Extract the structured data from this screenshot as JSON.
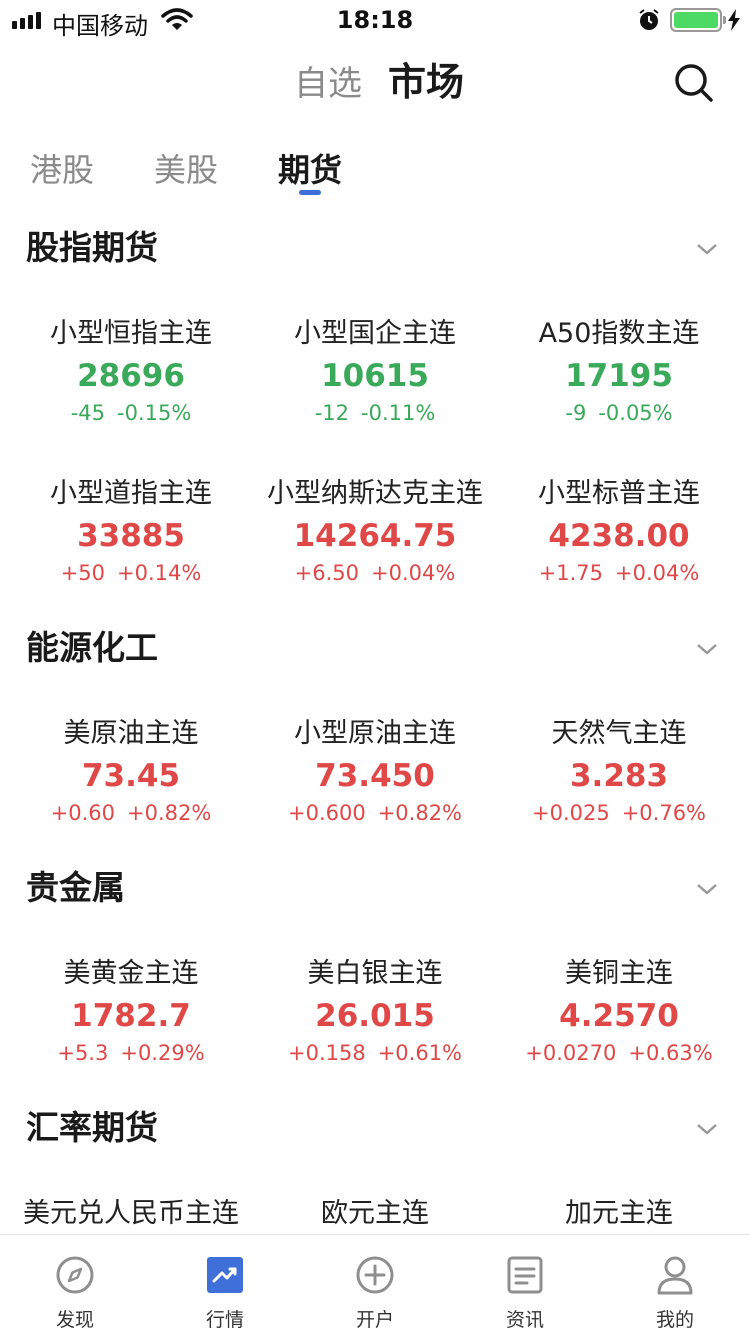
{
  "status_bar": {
    "carrier": "中国移动",
    "time": "18:18",
    "battery_color": "#4cd964"
  },
  "header": {
    "tab_watchlist": "自选",
    "tab_market": "市场"
  },
  "sub_tabs": [
    "港股",
    "美股",
    "期货"
  ],
  "colors": {
    "up": "#e04848",
    "down": "#3aaa5a",
    "accent": "#3f6fd8"
  },
  "sections": [
    {
      "title": "股指期货",
      "items": [
        {
          "name": "小型恒指主连",
          "price": "28696",
          "change": "-45",
          "pct": "-0.15%",
          "trend": "down"
        },
        {
          "name": "小型国企主连",
          "price": "10615",
          "change": "-12",
          "pct": "-0.11%",
          "trend": "down"
        },
        {
          "name": "A50指数主连",
          "price": "17195",
          "change": "-9",
          "pct": "-0.05%",
          "trend": "down"
        },
        {
          "name": "小型道指主连",
          "price": "33885",
          "change": "+50",
          "pct": "+0.14%",
          "trend": "up"
        },
        {
          "name": "小型纳斯达克主连",
          "price": "14264.75",
          "change": "+6.50",
          "pct": "+0.04%",
          "trend": "up"
        },
        {
          "name": "小型标普主连",
          "price": "4238.00",
          "change": "+1.75",
          "pct": "+0.04%",
          "trend": "up"
        }
      ]
    },
    {
      "title": "能源化工",
      "items": [
        {
          "name": "美原油主连",
          "price": "73.45",
          "change": "+0.60",
          "pct": "+0.82%",
          "trend": "up"
        },
        {
          "name": "小型原油主连",
          "price": "73.450",
          "change": "+0.600",
          "pct": "+0.82%",
          "trend": "up"
        },
        {
          "name": "天然气主连",
          "price": "3.283",
          "change": "+0.025",
          "pct": "+0.76%",
          "trend": "up"
        }
      ]
    },
    {
      "title": "贵金属",
      "items": [
        {
          "name": "美黄金主连",
          "price": "1782.7",
          "change": "+5.3",
          "pct": "+0.29%",
          "trend": "up"
        },
        {
          "name": "美白银主连",
          "price": "26.015",
          "change": "+0.158",
          "pct": "+0.61%",
          "trend": "up"
        },
        {
          "name": "美铜主连",
          "price": "4.2570",
          "change": "+0.0270",
          "pct": "+0.63%",
          "trend": "up"
        }
      ]
    },
    {
      "title": "汇率期货",
      "items": [
        {
          "name": "美元兑人民币主连"
        },
        {
          "name": "欧元主连"
        },
        {
          "name": "加元主连"
        }
      ]
    }
  ],
  "bottom_nav": [
    {
      "label": "发现",
      "icon": "compass-icon"
    },
    {
      "label": "行情",
      "icon": "chart-icon",
      "active": true
    },
    {
      "label": "开户",
      "icon": "plus-circle-icon"
    },
    {
      "label": "资讯",
      "icon": "news-icon"
    },
    {
      "label": "我的",
      "icon": "person-icon"
    }
  ]
}
